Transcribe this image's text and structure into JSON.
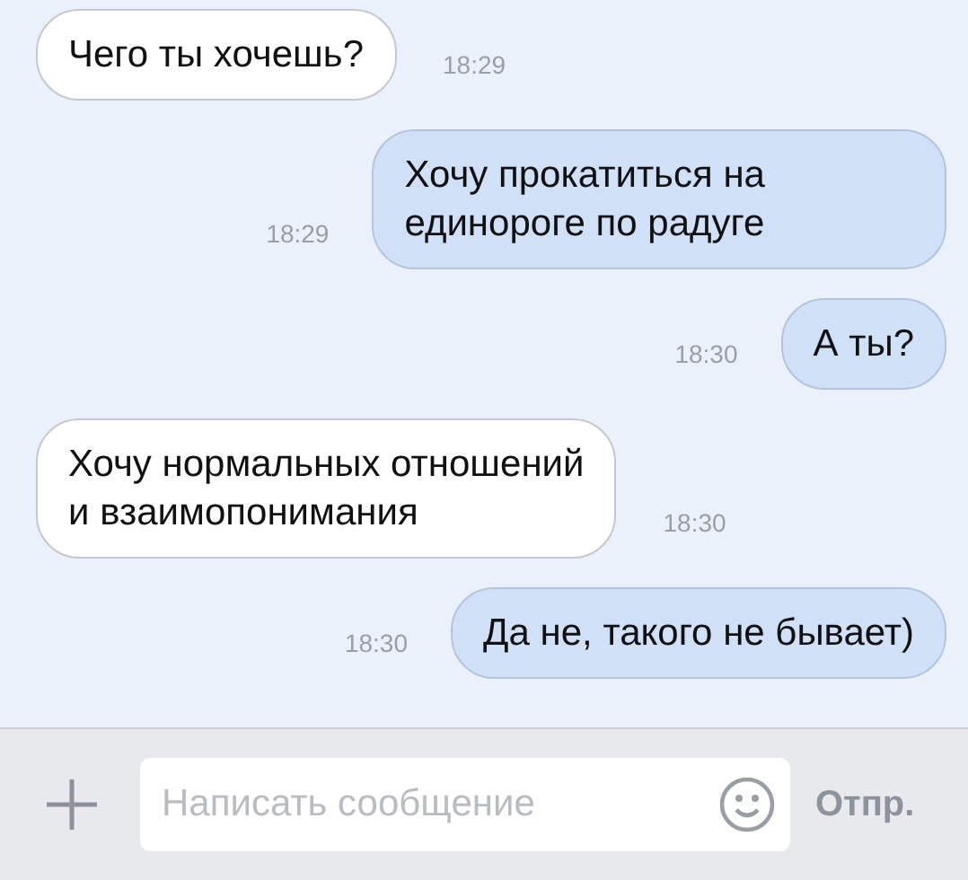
{
  "messages": [
    {
      "kind": "incoming",
      "text": "Чего ты хочешь?",
      "time": "18:29"
    },
    {
      "kind": "outgoing",
      "text": "Хочу прокатиться на\nединороге по радуге",
      "time": "18:29"
    },
    {
      "kind": "outgoing",
      "text": "А ты?",
      "time": "18:30"
    },
    {
      "kind": "incoming",
      "text": "Хочу нормальных отношений\nи взаимопонимания",
      "time": "18:30"
    },
    {
      "kind": "outgoing",
      "text": "Да не, такого не бывает)",
      "time": "18:30"
    }
  ],
  "composer": {
    "placeholder": "Написать сообщение",
    "send": "Отпр."
  }
}
